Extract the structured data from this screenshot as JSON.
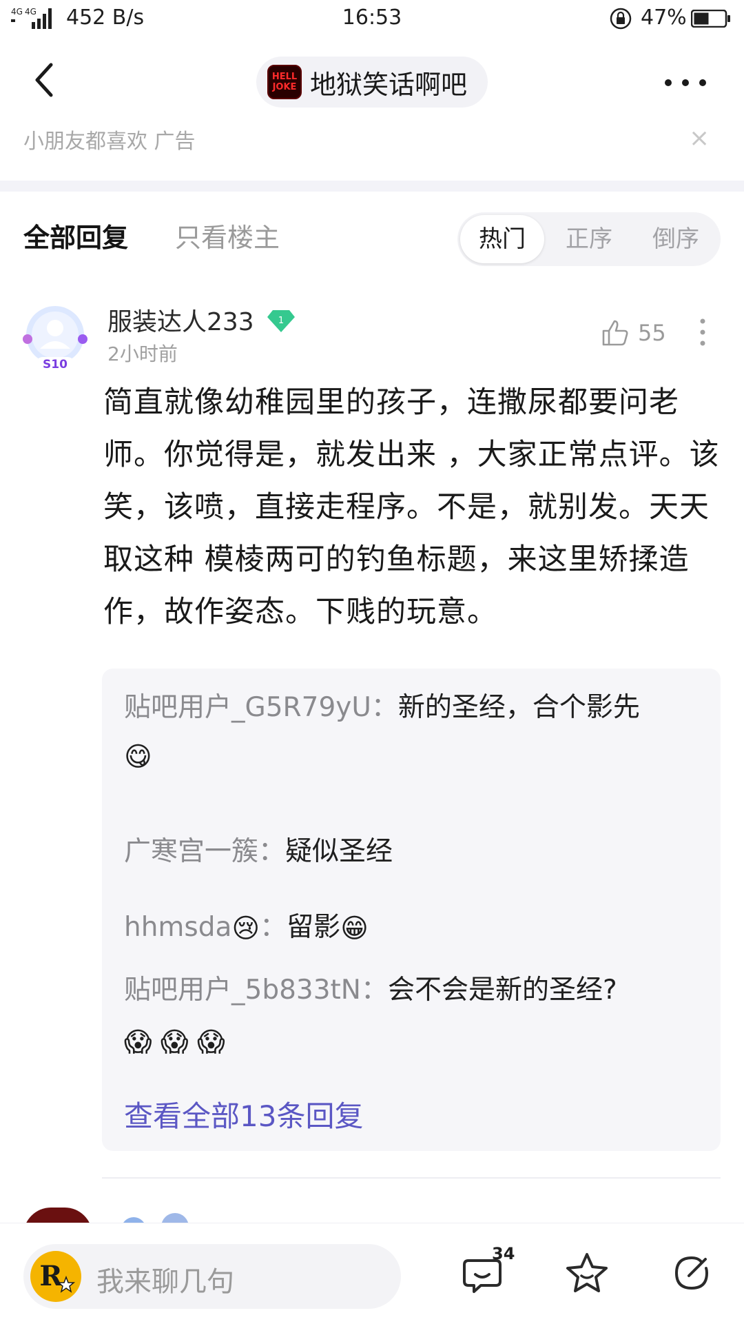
{
  "status_bar": {
    "network": "4G 4G",
    "speed": "452 B/s",
    "time": "16:53",
    "battery": "47%"
  },
  "nav": {
    "forum_logo_line1": "HELL",
    "forum_logo_line2": "JOKE",
    "forum_name": "地狱笑话啊吧"
  },
  "ad": {
    "text": "小朋友都喜欢  广告",
    "close": "×"
  },
  "tabs": {
    "all": "全部回复",
    "op_only": "只看楼主",
    "sort": [
      "热门",
      "正序",
      "倒序"
    ],
    "sort_active": "热门"
  },
  "comment": {
    "username": "服装达人233",
    "level": "1",
    "avatar_badge": "S10",
    "time": "2小时前",
    "likes": "55",
    "body": "简直就像幼稚园里的孩子，连撒尿都要问老师。你觉得是，就发出来 ，大家正常点评。该笑，该喷，直接走程序。不是，就别发。天天取这种 模棱两可的钓鱼标题，来这里矫揉造作，故作姿态。下贱的玩意。",
    "replies": [
      {
        "user": "贴吧用户_G5R79yU：",
        "text": "新的圣经，合个影先",
        "emoji": "😋"
      },
      {
        "user": "广寒宫一簇：",
        "text": "疑似圣经"
      },
      {
        "user": "hhmsda",
        "user_emoji": "😢",
        "sep": "：",
        "text": "留影",
        "emoji": "😁"
      },
      {
        "user": "贴吧用户_5b833tN：",
        "text": "会不会是新的圣经?",
        "emoji": "😱 😱 😱"
      }
    ],
    "view_all": "查看全部13条回复"
  },
  "bottom_bar": {
    "placeholder": "我来聊几句",
    "avatar_letter": "R",
    "reply_count": "34"
  },
  "colors": {
    "accent": "#5b57c4",
    "level_badge": "#35c98f"
  }
}
